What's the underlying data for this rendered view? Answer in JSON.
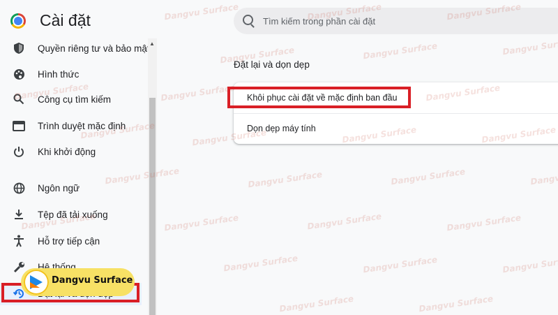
{
  "app": {
    "title": "Cài đặt",
    "logo_icon": "chrome-logo-icon"
  },
  "search": {
    "placeholder": "Tìm kiếm trong phần cài đặt"
  },
  "sidebar": {
    "items": [
      {
        "label": "Quyền riêng tư và bảo mật",
        "icon": "shield-icon"
      },
      {
        "label": "Hình thức",
        "icon": "palette-icon"
      },
      {
        "label": "Công cụ tìm kiếm",
        "icon": "search-icon"
      },
      {
        "label": "Trình duyệt mặc định",
        "icon": "browser-icon"
      },
      {
        "label": "Khi khởi động",
        "icon": "power-icon"
      },
      {
        "label": "Ngôn ngữ",
        "icon": "globe-icon"
      },
      {
        "label": "Tệp đã tải xuống",
        "icon": "download-icon"
      },
      {
        "label": "Hỗ trợ tiếp cận",
        "icon": "accessibility-icon"
      },
      {
        "label": "Hệ thống",
        "icon": "wrench-icon"
      },
      {
        "label": "Đặt lại và dọn dẹp",
        "icon": "restore-icon",
        "active": true
      }
    ]
  },
  "main": {
    "section_title": "Đặt lại và dọn dẹp",
    "options": [
      {
        "label": "Khôi phục cài đặt về mặc định ban đầu"
      },
      {
        "label": "Dọn dẹp máy tính"
      }
    ]
  },
  "overlay": {
    "badge_text": "Dangvu Surface",
    "watermark_text": "Dangvu Surface"
  },
  "colors": {
    "highlight": "#d91f26",
    "badge": "#f7e165",
    "active_row": "#e8f0fe"
  }
}
